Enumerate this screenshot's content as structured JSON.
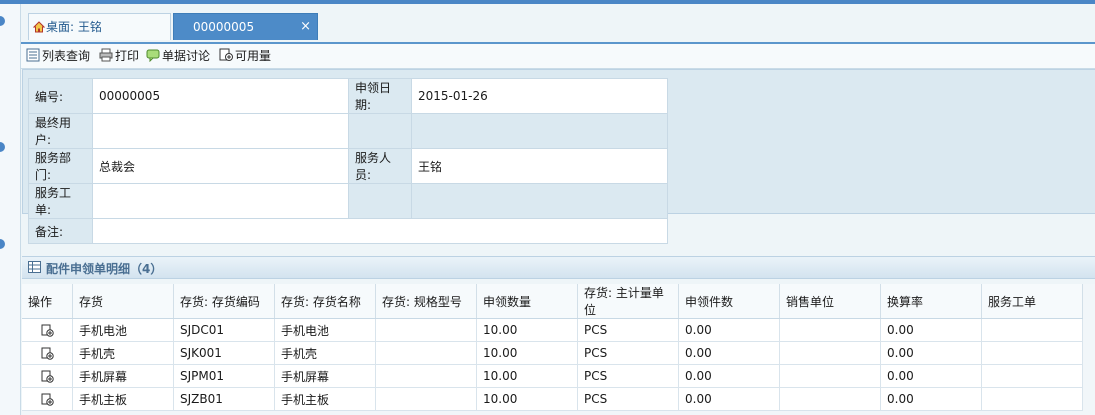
{
  "tabs": [
    {
      "label": "桌面: 王铭",
      "icon": "home-icon"
    },
    {
      "label": "00000005",
      "icon": "close-icon",
      "close": "×"
    }
  ],
  "toolbar": [
    {
      "label": "列表查询",
      "icon": "list-icon"
    },
    {
      "label": "打印",
      "icon": "printer-icon"
    },
    {
      "label": "单据讨论",
      "icon": "chat-icon"
    },
    {
      "label": "可用量",
      "icon": "stock-icon"
    }
  ],
  "form": {
    "code_label": "编号:",
    "code_value": "00000005",
    "date_label": "申领日期:",
    "date_value": "2015-01-26",
    "enduser_label": "最终用户:",
    "enduser_value": "",
    "dept_label": "服务部门:",
    "dept_value": "总裁会",
    "staff_label": "服务人员:",
    "staff_value": "王铭",
    "order_label": "服务工单:",
    "order_value": "",
    "note_label": "备注:",
    "note_value": ""
  },
  "detail": {
    "title": "配件申领单明细（4）",
    "columns": [
      "操作",
      "存货",
      "存货: 存货编码",
      "存货: 存货名称",
      "存货: 规格型号",
      "申领数量",
      "存货: 主计量单位",
      "申领件数",
      "销售单位",
      "换算率",
      "服务工单"
    ],
    "rows": [
      [
        "手机电池",
        "SJDC01",
        "手机电池",
        "",
        "10.00",
        "PCS",
        "0.00",
        "",
        "0.00",
        ""
      ],
      [
        "手机壳",
        "SJK001",
        "手机壳",
        "",
        "10.00",
        "PCS",
        "0.00",
        "",
        "0.00",
        ""
      ],
      [
        "手机屏幕",
        "SJPM01",
        "手机屏幕",
        "",
        "10.00",
        "PCS",
        "0.00",
        "",
        "0.00",
        ""
      ],
      [
        "手机主板",
        "SJZB01",
        "手机主板",
        "",
        "10.00",
        "PCS",
        "0.00",
        "",
        "0.00",
        ""
      ]
    ]
  },
  "colors": {
    "accent": "#4d8bc8",
    "panel": "#dbe9f1",
    "title": "#4a6f92"
  }
}
